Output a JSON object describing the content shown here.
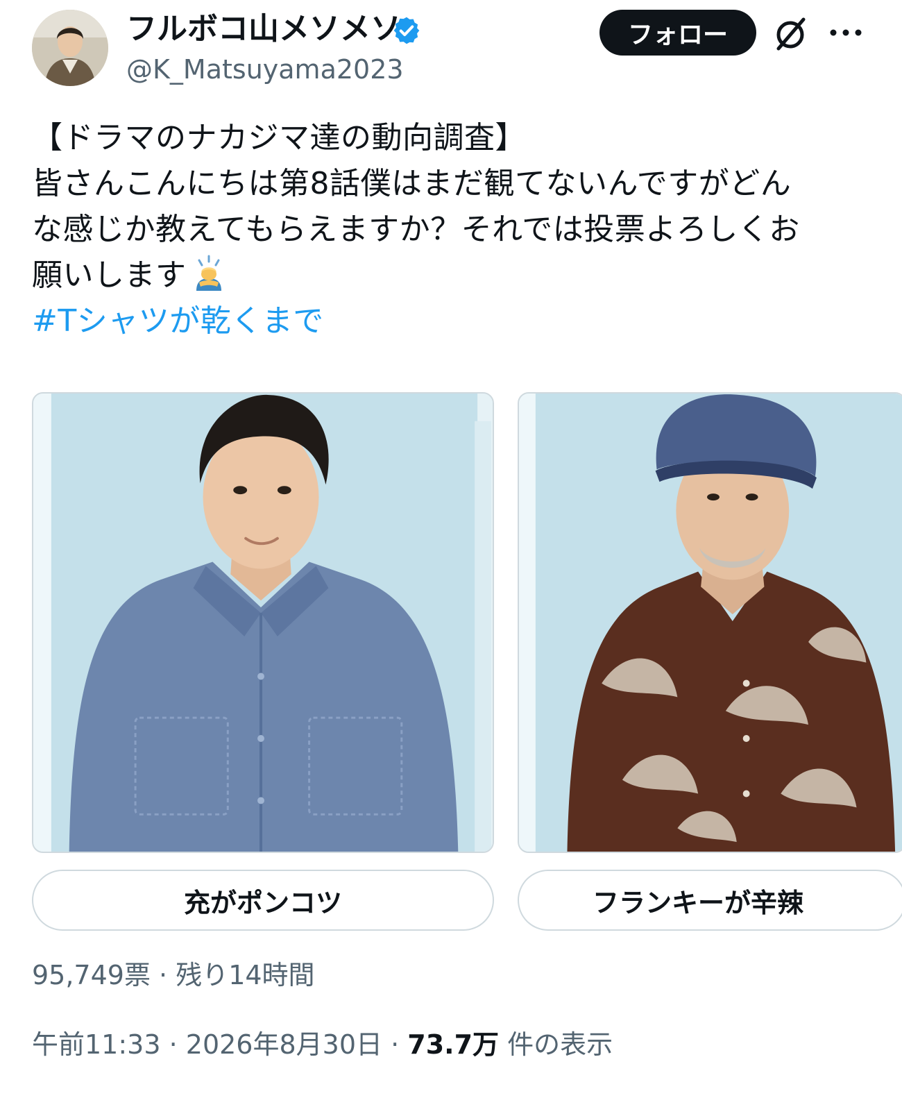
{
  "author": {
    "display_name": "フルボコ山メソメソ",
    "handle": "@K_Matsuyama2023",
    "verified": true
  },
  "actions": {
    "follow_label": "フォロー",
    "grok_icon": "grok-icon",
    "more_icon": "more-icon"
  },
  "tweet": {
    "lines": [
      "【ドラマのナカジマ達の動向調査】",
      "皆さんこんにちは第8話僕はまだ観てないんですがどん",
      "な感じか教えてもらえますか？それでは投票よろしくお",
      "願いします"
    ],
    "emoji": "bowing-person-icon",
    "hashtag": "#Tシャツが乾くまで"
  },
  "poll": {
    "options": [
      {
        "label": "充がポンコツ",
        "image": "man-in-denim-shirt-photo"
      },
      {
        "label": "フランキーが辛辣",
        "image": "man-in-hat-brown-shirt-photo"
      }
    ],
    "meta": "95,749票 · 残り14時間"
  },
  "footer": {
    "time": "午前11:33",
    "sep1": " · ",
    "date": "2026年8月30日",
    "sep2": " · ",
    "views": "73.7万",
    "views_suffix": " 件の表示"
  },
  "colors": {
    "link": "#1d9bf0",
    "verified": "#1d9bf0",
    "text": "#0f1419",
    "secondary": "#536471",
    "border": "#cfd9de"
  }
}
